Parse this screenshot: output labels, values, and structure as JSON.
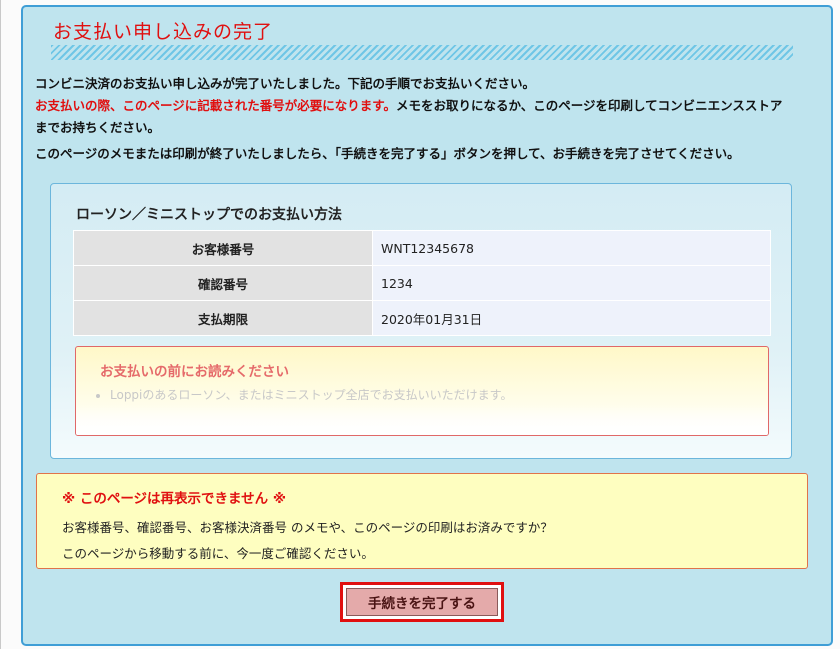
{
  "page": {
    "title": "お支払い申し込みの完了"
  },
  "intro": {
    "line1": "コンビニ決済のお支払い申し込みが完了いたしました。下記の手順でお支払いください。",
    "line2_red": "お支払いの際、このページに記載された番号が必要になります。",
    "line2_rest": "メモをお取りになるか、このページを印刷してコンビニエンスストア",
    "line3": "までお持ちください。",
    "line4": "このページのメモまたは印刷が終了いたしましたら、「手続きを完了する」ボタンを押して、お手続きを完了させてください。"
  },
  "payment_box": {
    "title": "ローソン／ミニストップでのお支払い方法",
    "rows": [
      {
        "label": "お客様番号",
        "value": "WNT12345678"
      },
      {
        "label": "確認番号",
        "value": "1234"
      },
      {
        "label": "支払期限",
        "value": "2020年01月31日"
      }
    ],
    "notice": {
      "heading": "お支払いの前にお読みください",
      "item1": "Loppiのあるローソン、またはミニストップ全店でお支払いいただけます。"
    }
  },
  "warning": {
    "heading": "※ このページは再表示できません ※",
    "line1": "お客様番号、確認番号、お客様決済番号 のメモや、このページの印刷はお済みですか？",
    "line2": "このページから移動する前に、今一度ご確認ください。"
  },
  "actions": {
    "complete_label": "手続きを完了する"
  }
}
